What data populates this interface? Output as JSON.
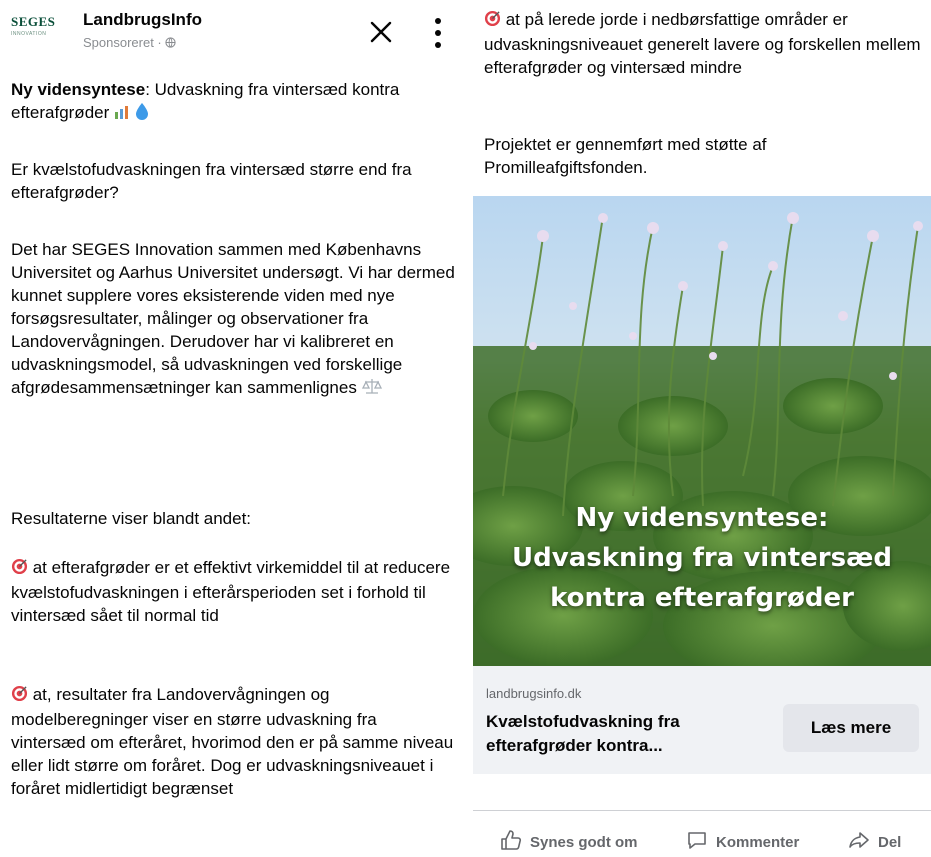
{
  "post": {
    "page_name": "LandbrugsInfo",
    "sponsored": "Sponsoreret · ",
    "logo_text": "SEGES",
    "logo_sub": "INNOVATION",
    "headline_bold": "Ny vidensyntese",
    "headline_rest": ": Udvaskning fra vintersæd kontra efterafgrøder",
    "question": "Er kvælstofudvaskningen fra vintersæd større end fra efterafgrøder?",
    "body": "Det har SEGES Innovation sammen med Københavns Universitet og Aarhus Universitet undersøgt. Vi har dermed kunnet supplere vores eksisterende viden med nye forsøgsresultater, målinger og observationer fra Landovervågningen. Derudover har vi kalibreret en udvaskningsmodel, så udvaskningen ved forskellige afgrødesammensætninger kan sammenlignes",
    "results_intro": "Resultaterne viser blandt andet:",
    "result1": " at efterafgrøder er et effektivt virkemiddel til at reducere kvælstofudvaskningen i efterårsperioden set i forhold til vintersæd sået til normal tid",
    "result2": " at, resultater fra Landovervågningen og modelberegninger viser en større udvaskning fra vintersæd om efteråret, hvorimod den er på samme niveau eller lidt større om foråret. Dog er udvaskningsniveauet i foråret midlertidigt begrænset",
    "result3": " at på lerede jorde i nedbørsfattige områder er udvaskningsniveauet generelt lavere og forskellen mellem efterafgrøder og vintersæd mindre",
    "support": "Projektet er gennemført med støtte af Promilleafgiftsfonden."
  },
  "hero": {
    "line1": "Ny vidensyntese:",
    "line2": "Udvaskning fra vintersæd",
    "line3": "kontra efterafgrøder"
  },
  "link": {
    "domain": "landbrugsinfo.dk",
    "title": "Kvælstofudvaskning fra efterafgrøder kontra...",
    "cta": "Læs mere"
  },
  "actions": {
    "like": "Synes godt om",
    "comment": "Kommenter",
    "share": "Del"
  },
  "icons": {
    "close": "close-icon",
    "more": "more-vertical-icon",
    "globe": "globe-icon",
    "target": "target-emoji-icon",
    "chart": "bar-chart-emoji-icon",
    "droplet": "droplet-emoji-icon",
    "scales": "balance-scale-emoji-icon",
    "like": "thumbs-up-icon",
    "comment": "comment-icon",
    "share": "share-icon"
  },
  "colors": {
    "text": "#050505",
    "muted": "#65676b",
    "link_card_bg": "#f0f2f5",
    "button_bg": "#e4e6eb",
    "logo_green": "#0b4f3a"
  }
}
